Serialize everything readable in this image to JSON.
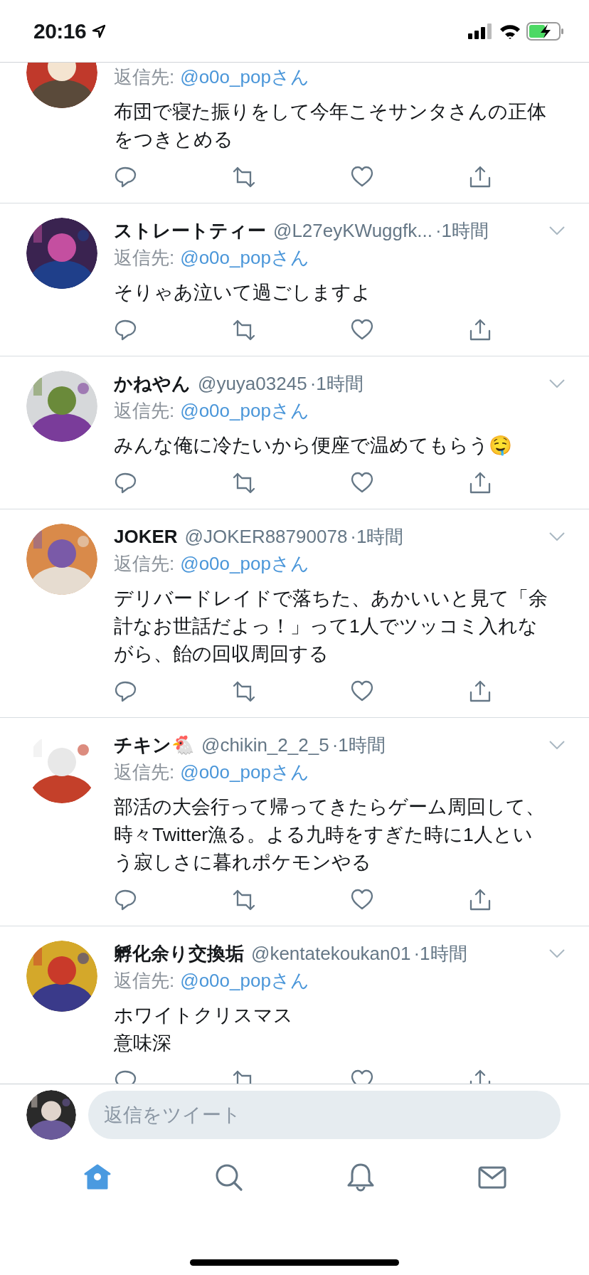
{
  "status_bar": {
    "time": "20:16"
  },
  "tweets": [
    {
      "reply_label": "返信先:",
      "reply_to": "@o0o_popさん",
      "text": [
        "布団で寝た振りをして今年こそサンタさんの正体をつきとめる"
      ]
    },
    {
      "name": "ストレートティー",
      "handle": "@L27eyKWuggfk...",
      "time": "·1時間",
      "reply_label": "返信先:",
      "reply_to": "@o0o_popさん",
      "text": [
        "そりゃあ泣いて過ごしますよ"
      ]
    },
    {
      "name": "かねやん",
      "handle": "@yuya03245",
      "time": "·1時間",
      "reply_label": "返信先:",
      "reply_to": "@o0o_popさん",
      "text": [
        "みんな俺に冷たいから便座で温めてもらう🤤"
      ]
    },
    {
      "name": "JOKER",
      "handle": "@JOKER88790078",
      "time": "·1時間",
      "reply_label": "返信先:",
      "reply_to": "@o0o_popさん",
      "text": [
        "デリバードレイドで落ちた、あかいいと見て「余計なお世話だよっ！」って1人でツッコミ入れながら、飴の回収周回する"
      ]
    },
    {
      "name": "チキン🐔",
      "handle": "@chikin_2_2_5",
      "time": "·1時間",
      "reply_label": "返信先:",
      "reply_to": "@o0o_popさん",
      "text": [
        "部活の大会行って帰ってきたらゲーム周回して、時々Twitter漁る。よる九時をすぎた時に1人という寂しさに暮れポケモンやる"
      ]
    },
    {
      "name": "孵化余り交換垢",
      "handle": "@kentatekoukan01",
      "time": "·1時間",
      "reply_label": "返信先:",
      "reply_to": "@o0o_popさん",
      "text": [
        "ホワイトクリスマス",
        "意味深"
      ]
    }
  ],
  "reply_bar": {
    "placeholder": "返信をツイート"
  },
  "tab_bar": [
    {
      "kind": "home",
      "selected": true
    },
    {
      "kind": "search",
      "selected": false
    },
    {
      "kind": "notifications",
      "selected": false
    },
    {
      "kind": "messages",
      "selected": false
    }
  ]
}
